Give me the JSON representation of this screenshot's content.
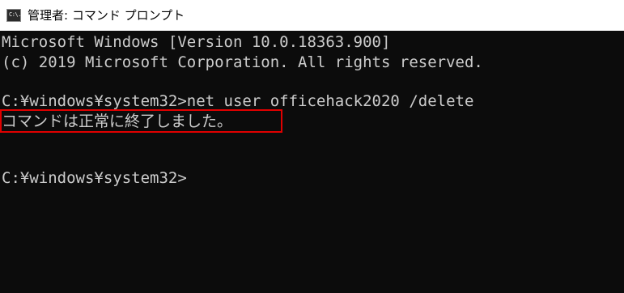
{
  "window": {
    "title": "管理者: コマンド プロンプト",
    "icon": "cmd-icon",
    "icon_text": "C:\\."
  },
  "console": {
    "lines": [
      "Microsoft Windows [Version 10.0.18363.900]",
      "(c) 2019 Microsoft Corporation. All rights reserved.",
      "C:¥windows¥system32>net user officehack2020 /delete",
      "コマンドは正常に終了しました。",
      "C:¥windows¥system32>"
    ]
  },
  "colors": {
    "console_background": "#0c0c0c",
    "console_text": "#cccccc",
    "titlebar_background": "#ffffff",
    "highlight_border": "#e00000"
  }
}
